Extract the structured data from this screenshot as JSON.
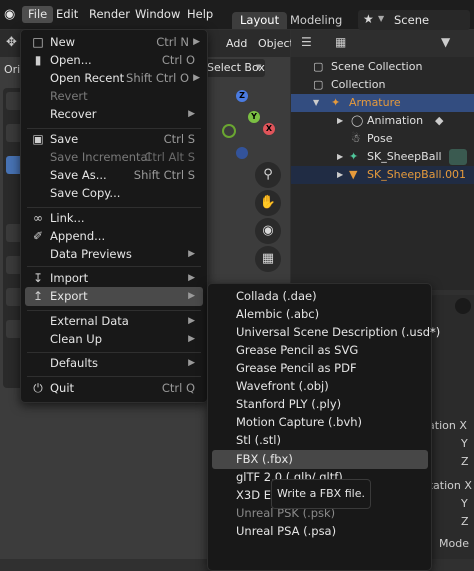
{
  "topbar": {
    "menus": [
      "File",
      "Edit",
      "Render",
      "Window",
      "Help"
    ],
    "workspaces": [
      "Layout",
      "Modeling"
    ],
    "scene_label": "Scene"
  },
  "viewport": {
    "header_items": [
      "Add",
      "Object"
    ],
    "select_box": "Select Box",
    "ori_label": "Ori",
    "axes": [
      "Z",
      "Y",
      "X"
    ]
  },
  "outliner": {
    "rows": [
      {
        "label": "Scene Collection"
      },
      {
        "label": "Collection"
      },
      {
        "label": "Armature"
      },
      {
        "label": "Animation"
      },
      {
        "label": "Pose"
      },
      {
        "label": "SK_SheepBall"
      },
      {
        "label": "SK_SheepBall.001"
      }
    ]
  },
  "properties": {
    "labels": [
      "cation X",
      "Y",
      "Z",
      "otation X",
      "Y",
      "Z",
      "Mode"
    ]
  },
  "file_menu": {
    "items": [
      {
        "label": "New",
        "shortcut": "Ctrl N",
        "icon": "new-file-icon",
        "submenu": true
      },
      {
        "label": "Open...",
        "shortcut": "Ctrl O",
        "icon": "folder-icon"
      },
      {
        "label": "Open Recent",
        "shortcut": "Shift Ctrl O",
        "submenu": true
      },
      {
        "label": "Revert",
        "disabled": true
      },
      {
        "label": "Recover",
        "submenu": true
      },
      {
        "label": "Save",
        "shortcut": "Ctrl S",
        "icon": "save-icon"
      },
      {
        "label": "Save Incremental",
        "shortcut": "Ctrl Alt S",
        "disabled": true
      },
      {
        "label": "Save As...",
        "shortcut": "Shift Ctrl S"
      },
      {
        "label": "Save Copy..."
      },
      {
        "label": "Link...",
        "icon": "link-icon"
      },
      {
        "label": "Append...",
        "icon": "append-icon"
      },
      {
        "label": "Data Previews",
        "submenu": true
      },
      {
        "label": "Import",
        "icon": "import-icon",
        "submenu": true
      },
      {
        "label": "Export",
        "icon": "export-icon",
        "submenu": true,
        "active": true
      },
      {
        "label": "External Data",
        "submenu": true
      },
      {
        "label": "Clean Up",
        "submenu": true
      },
      {
        "label": "Defaults",
        "submenu": true
      },
      {
        "label": "Quit",
        "shortcut": "Ctrl Q",
        "icon": "power-icon"
      }
    ]
  },
  "export_menu": {
    "items": [
      {
        "label": "Collada (.dae)"
      },
      {
        "label": "Alembic (.abc)"
      },
      {
        "label": "Universal Scene Description (.usd*)"
      },
      {
        "label": "Grease Pencil as SVG"
      },
      {
        "label": "Grease Pencil as PDF"
      },
      {
        "label": "Wavefront (.obj)"
      },
      {
        "label": "Stanford PLY (.ply)"
      },
      {
        "label": "Motion Capture (.bvh)"
      },
      {
        "label": "Stl (.stl)"
      },
      {
        "label": "FBX (.fbx)",
        "hover": true
      },
      {
        "label": "glTF 2.0 (.glb/.gltf)"
      },
      {
        "label": "X3D Ex"
      },
      {
        "label": "Unreal PSK (.psk)",
        "disabled": true
      },
      {
        "label": "Unreal PSA (.psa)"
      }
    ]
  },
  "tooltip": {
    "text": "Write a FBX file."
  },
  "colors": {
    "accent": "#4772b3",
    "highlight_row": "#334d80",
    "armature_orange": "#e59a3c"
  }
}
